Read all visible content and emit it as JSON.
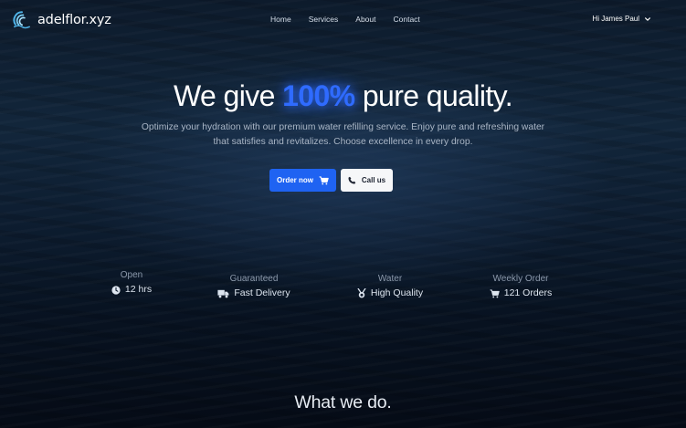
{
  "navbar": {
    "brand": {
      "name": "adelflor.xyz",
      "logo_icon": "wave-logo-icon"
    },
    "links": [
      {
        "label": "Home"
      },
      {
        "label": "Services"
      },
      {
        "label": "About"
      },
      {
        "label": "Contact"
      }
    ],
    "user_menu": {
      "label": "Hi James Paul",
      "icon": "chevron-down-icon"
    }
  },
  "hero": {
    "title_before": "We give ",
    "title_accent": "100%",
    "title_after": " pure quality.",
    "subtitle": "Optimize your hydration with our premium water refilling service. Enjoy pure and refreshing water that satisfies and revitalizes. Choose excellence in every drop.",
    "buttons": {
      "order": {
        "label": "Order now",
        "icon": "cart-icon"
      },
      "call": {
        "label": "Call us",
        "icon": "phone-icon"
      }
    }
  },
  "stats": [
    {
      "label": "Open",
      "value": "12 hrs",
      "icon": "clock-icon"
    },
    {
      "label": "Guaranteed",
      "value": "Fast Delivery",
      "icon": "truck-icon"
    },
    {
      "label": "Water",
      "value": "High Quality",
      "icon": "medal-icon"
    },
    {
      "label": "Weekly Order",
      "value": "121 Orders",
      "icon": "cart-icon"
    }
  ],
  "section": {
    "title": "What we do."
  },
  "colors": {
    "accent": "#2f6bff",
    "primary_button": "#1f63f2",
    "background": "#0d1b2c"
  }
}
